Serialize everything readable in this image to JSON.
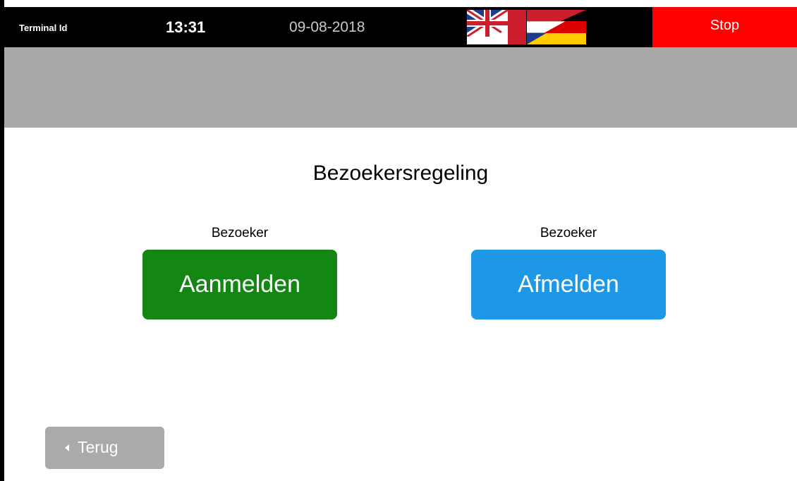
{
  "header": {
    "terminal_label": "Terminal Id",
    "time": "13:31",
    "date": "09-08-2018",
    "stop_label": "Stop",
    "languages": [
      "english-flag-icon",
      "dutch-german-flag-icon"
    ]
  },
  "main": {
    "title": "Bezoekersregeling",
    "actions": [
      {
        "caption": "Bezoeker",
        "label": "Aanmelden",
        "color": "#138613"
      },
      {
        "caption": "Bezoeker",
        "label": "Afmelden",
        "color": "#1e98e6"
      }
    ]
  },
  "footer": {
    "back_label": "Terug"
  },
  "colors": {
    "stop": "#ff0000",
    "greybar": "#a9a9a9",
    "back": "#aaaaaa"
  }
}
